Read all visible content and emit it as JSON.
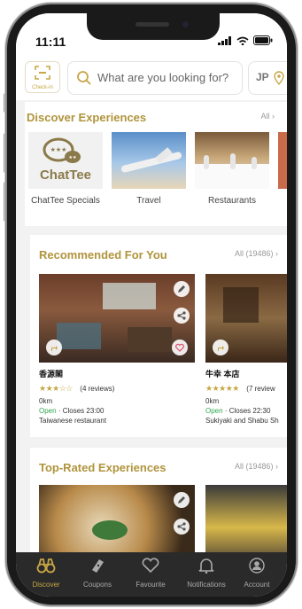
{
  "status": {
    "time": "11:11"
  },
  "header": {
    "checkin_label": "Check-in",
    "search_placeholder": "What are you looking for?",
    "lang": "JP"
  },
  "discover": {
    "title": "Discover Experiences",
    "all_label": "All",
    "items": [
      {
        "label": "ChatTee Specials",
        "logo_text": "ChatTee"
      },
      {
        "label": "Travel"
      },
      {
        "label": "Restaurants"
      }
    ]
  },
  "recommended": {
    "title": "Recommended For You",
    "all_label": "All (19486)",
    "items": [
      {
        "name": "香源閣",
        "rating": 3,
        "stars_text": "★★★☆☆",
        "reviews": "(4 reviews)",
        "distance": "0km",
        "open": "Open",
        "closes": "· Closes 23:00",
        "category": "Taiwanese restaurant"
      },
      {
        "name": "牛幸 本店",
        "rating": 4.5,
        "stars_text": "★★★★★",
        "reviews": "(7 review",
        "distance": "0km",
        "open": "Open",
        "closes": "· Closes 22:30",
        "category": "Sukiyaki and Shabu Sh"
      }
    ]
  },
  "toprated": {
    "title": "Top-Rated Experiences",
    "all_label": "All (19486)"
  },
  "tabs": [
    {
      "label": "Discover",
      "icon": "binoculars-icon"
    },
    {
      "label": "Coupons",
      "icon": "ticket-icon"
    },
    {
      "label": "Favourite",
      "icon": "heart-icon"
    },
    {
      "label": "Notifications",
      "icon": "bell-icon"
    },
    {
      "label": "Account",
      "icon": "user-icon"
    }
  ],
  "colors": {
    "accent": "#c7a645",
    "title": "#b0943c",
    "open": "#2fa84f",
    "tabbar": "#2a2a2a"
  }
}
